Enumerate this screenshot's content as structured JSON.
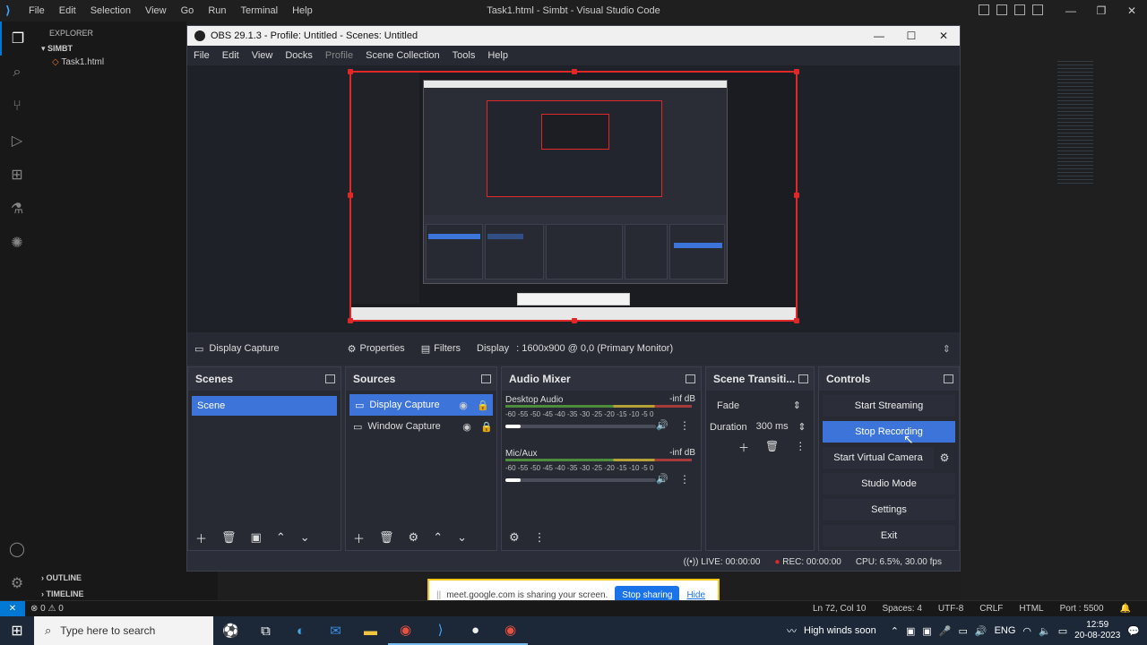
{
  "vscode": {
    "title": "Task1.html - Simbt - Visual Studio Code",
    "menu": [
      "File",
      "Edit",
      "Selection",
      "View",
      "Go",
      "Run",
      "Terminal",
      "Help"
    ],
    "explorer_label": "EXPLORER",
    "folder": "SIMBT",
    "file": "Task1.html",
    "outline": "OUTLINE",
    "timeline": "TIMELINE",
    "status": {
      "errors": "⊗ 0 ⚠ 0",
      "position": "Ln 72, Col 10",
      "spaces": "Spaces: 4",
      "encoding": "UTF-8",
      "eol": "CRLF",
      "language": "HTML",
      "port": "Port : 5500"
    }
  },
  "obs": {
    "title": "OBS 29.1.3 - Profile: Untitled - Scenes: Untitled",
    "menu": [
      "File",
      "Edit",
      "View",
      "Docks",
      "Profile",
      "Scene Collection",
      "Tools",
      "Help"
    ],
    "source_bar": {
      "source": "Display Capture",
      "properties": "Properties",
      "filters": "Filters",
      "display_label": "Display",
      "display_value": ": 1600x900 @ 0,0 (Primary Monitor)"
    },
    "scenes": {
      "title": "Scenes",
      "items": [
        "Scene"
      ]
    },
    "sources": {
      "title": "Sources",
      "items": [
        "Display Capture",
        "Window Capture"
      ]
    },
    "mixer": {
      "title": "Audio Mixer",
      "channels": [
        {
          "name": "Desktop Audio",
          "db": "-inf dB"
        },
        {
          "name": "Mic/Aux",
          "db": "-inf dB"
        }
      ],
      "scale": "-60 -55 -50 -45 -40 -35 -30 -25 -20 -15 -10 -5 0"
    },
    "transitions": {
      "title": "Scene Transiti...",
      "selected": "Fade",
      "duration_label": "Duration",
      "duration_value": "300 ms"
    },
    "controls": {
      "title": "Controls",
      "start_streaming": "Start Streaming",
      "stop_recording": "Stop Recording",
      "start_virtual_camera": "Start Virtual Camera",
      "studio_mode": "Studio Mode",
      "settings": "Settings",
      "exit": "Exit"
    },
    "status": {
      "live": "LIVE: 00:00:00",
      "rec": "REC: 00:00:00",
      "cpu": "CPU: 6.5%, 30.00 fps"
    }
  },
  "share_bar": {
    "message": "meet.google.com is sharing your screen.",
    "stop": "Stop sharing",
    "hide": "Hide"
  },
  "taskbar": {
    "search_placeholder": "Type here to search",
    "weather": "High winds soon",
    "lang": "ENG",
    "time": "12:59",
    "date": "20-08-2023"
  },
  "colors": {
    "accent": "#3d74d9",
    "selection_red": "#e02828",
    "vscode_blue": "#0078d4"
  }
}
